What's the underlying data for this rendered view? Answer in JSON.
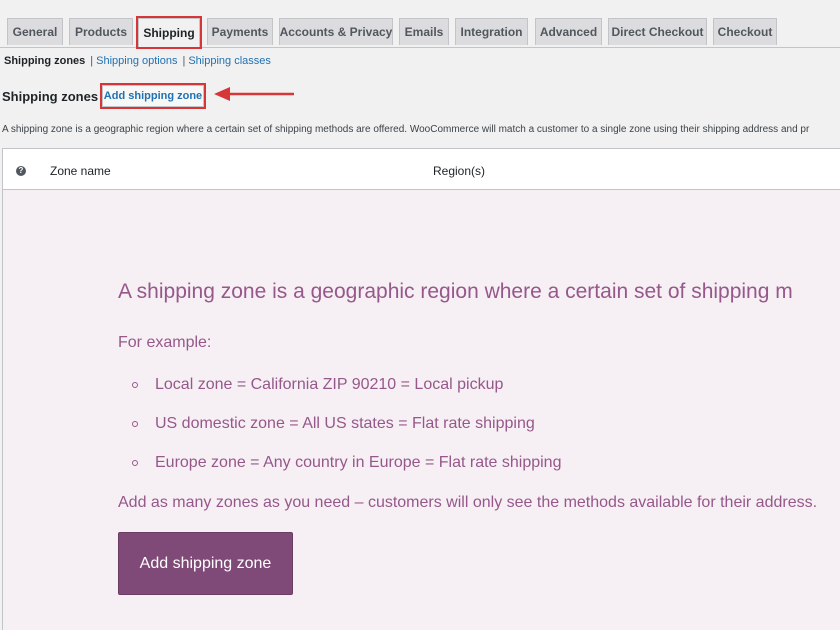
{
  "tabs": [
    "General",
    "Products",
    "Shipping",
    "Payments",
    "Accounts & Privacy",
    "Emails",
    "Integration",
    "Advanced",
    "Direct Checkout",
    "Checkout"
  ],
  "active_tab": "Shipping",
  "subnav": {
    "current": "Shipping zones",
    "links": [
      "Shipping options",
      "Shipping classes"
    ],
    "separator": "|"
  },
  "heading": "Shipping zones",
  "add_zone_small_label": "Add shipping zone",
  "description": "A shipping zone is a geographic region where a certain set of shipping methods are offered. WooCommerce will match a customer to a single zone using their shipping address and pr",
  "table": {
    "help_icon_glyph": "?",
    "columns": [
      "Zone name",
      "Region(s)"
    ]
  },
  "blank_state": {
    "title": "A shipping zone is a geographic region where a certain set of shipping m",
    "for_example": "For example:",
    "examples": [
      "Local zone = California ZIP 90210 = Local pickup",
      "US domestic zone = All US states = Flat rate shipping",
      "Europe zone = Any country in Europe = Flat rate shipping"
    ],
    "footer": "Add as many zones as you need – customers will only see the methods available for their address.",
    "button_label": "Add shipping zone"
  },
  "colors": {
    "accent_purple": "#96588a",
    "button_purple": "#7f4a78",
    "highlight_red": "#d63638",
    "link_blue": "#2271b1"
  }
}
